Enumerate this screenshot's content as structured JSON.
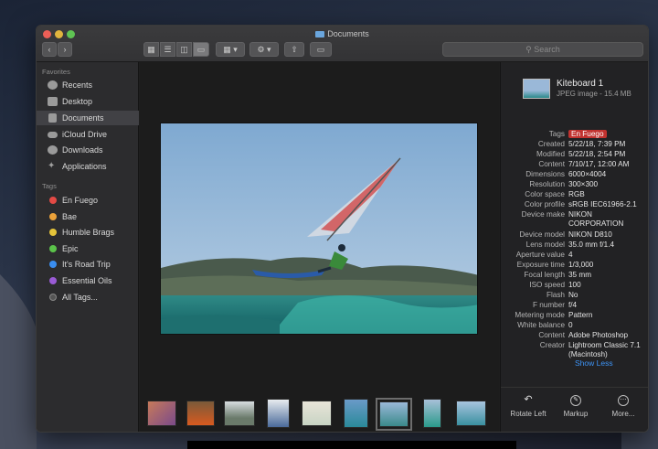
{
  "window": {
    "title": "Documents"
  },
  "toolbar": {
    "back_icon": "chevron-left-icon",
    "forward_icon": "chevron-right-icon",
    "search_placeholder": "Search"
  },
  "sidebar": {
    "favorites_heading": "Favorites",
    "favorites": [
      {
        "label": "Recents",
        "icon": "clock-icon"
      },
      {
        "label": "Desktop",
        "icon": "desktop-icon"
      },
      {
        "label": "Documents",
        "icon": "document-icon",
        "selected": true
      },
      {
        "label": "iCloud Drive",
        "icon": "cloud-icon"
      },
      {
        "label": "Downloads",
        "icon": "download-icon"
      },
      {
        "label": "Applications",
        "icon": "applications-icon"
      }
    ],
    "tags_heading": "Tags",
    "tags": [
      {
        "label": "En Fuego",
        "color": "#e34a45"
      },
      {
        "label": "Bae",
        "color": "#eca23a"
      },
      {
        "label": "Humble Brags",
        "color": "#e5c43a"
      },
      {
        "label": "Epic",
        "color": "#5bc34a"
      },
      {
        "label": "It's Road Trip",
        "color": "#3a8ef0"
      },
      {
        "label": "Essential Oils",
        "color": "#9a5bd6"
      },
      {
        "label": "All Tags...",
        "color": "#777777"
      }
    ]
  },
  "inspector": {
    "file_name": "Kiteboard 1",
    "file_meta": "JPEG image - 15.4 MB",
    "tag_label": "Tags",
    "tag_value": "En Fuego",
    "rows": [
      {
        "k": "Created",
        "v": "5/22/18, 7:39 PM"
      },
      {
        "k": "Modified",
        "v": "5/22/18, 2:54 PM"
      },
      {
        "k": "Content",
        "v": "7/10/17, 12:00 AM"
      },
      {
        "k": "Dimensions",
        "v": "6000×4004"
      },
      {
        "k": "Resolution",
        "v": "300×300"
      },
      {
        "k": "Color space",
        "v": "RGB"
      },
      {
        "k": "Color profile",
        "v": "sRGB IEC61966-2.1"
      },
      {
        "k": "Device make",
        "v": "NIKON CORPORATION"
      },
      {
        "k": "Device model",
        "v": "NIKON D810"
      },
      {
        "k": "Lens model",
        "v": "35.0 mm f/1.4"
      },
      {
        "k": "Aperture value",
        "v": "4"
      },
      {
        "k": "Exposure time",
        "v": "1/3,000"
      },
      {
        "k": "Focal length",
        "v": "35 mm"
      },
      {
        "k": "ISO speed",
        "v": "100"
      },
      {
        "k": "Flash",
        "v": "No"
      },
      {
        "k": "F number",
        "v": "f/4"
      },
      {
        "k": "Metering mode",
        "v": "Pattern"
      },
      {
        "k": "White balance",
        "v": "0"
      },
      {
        "k": "Content",
        "v": "Adobe Photoshop"
      },
      {
        "k": "Creator",
        "v": "Lightroom Classic 7.1 (Macintosh)"
      }
    ],
    "show_less": "Show Less",
    "actions": [
      {
        "label": "Rotate Left",
        "icon": "rotate-left-icon"
      },
      {
        "label": "Markup",
        "icon": "markup-icon"
      },
      {
        "label": "More...",
        "icon": "more-icon"
      }
    ]
  }
}
